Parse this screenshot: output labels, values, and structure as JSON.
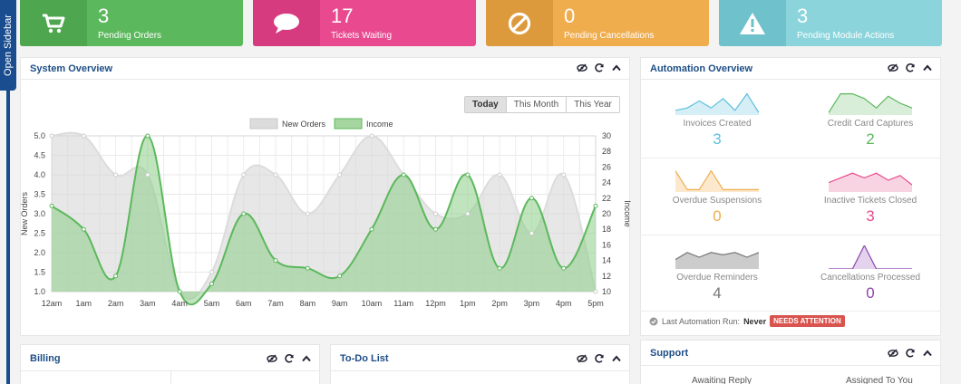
{
  "sidebar": {
    "label": "Open Sidebar"
  },
  "tiles": [
    {
      "value": "3",
      "label": "Pending Orders",
      "icon": "shopping-cart-icon",
      "color": "#5cb85c",
      "icon_bg": "#4ea64e"
    },
    {
      "value": "17",
      "label": "Tickets Waiting",
      "icon": "speech-bubble-icon",
      "color": "#e8498f",
      "icon_bg": "#d63a7f"
    },
    {
      "value": "0",
      "label": "Pending Cancellations",
      "icon": "ban-icon",
      "color": "#f0ad4e",
      "icon_bg": "#dc9a3c"
    },
    {
      "value": "3",
      "label": "Pending Module Actions",
      "icon": "warning-icon",
      "color": "#8bd4dc",
      "icon_bg": "#6fc2cb"
    }
  ],
  "system_overview": {
    "title": "System Overview",
    "ranges": [
      "Today",
      "This Month",
      "This Year"
    ],
    "active_range": "Today"
  },
  "chart_data": {
    "type": "line",
    "categories": [
      "12am",
      "1am",
      "2am",
      "3am",
      "4am",
      "5am",
      "6am",
      "7am",
      "8am",
      "9am",
      "10am",
      "11am",
      "12pm",
      "1pm",
      "2pm",
      "3pm",
      "4pm",
      "5pm"
    ],
    "series": [
      {
        "name": "New Orders",
        "axis": "left",
        "color": "#dcdcdc",
        "values": [
          5.0,
          5.0,
          4.0,
          4.0,
          1.0,
          1.5,
          4.0,
          4.0,
          3.0,
          4.0,
          5.0,
          4.0,
          3.0,
          3.0,
          4.0,
          2.5,
          4.0,
          1.0
        ]
      },
      {
        "name": "Income",
        "axis": "right",
        "color": "#5cb85c",
        "values": [
          21,
          18,
          12,
          30,
          10,
          11,
          20,
          14,
          13,
          12,
          18,
          25,
          18,
          25,
          13,
          22,
          13,
          21
        ]
      }
    ],
    "ylabel": "New Orders",
    "ylabel_right": "Income",
    "ylim": [
      1.0,
      5.0
    ],
    "yticks": [
      "5.0",
      "4.5",
      "4.0",
      "3.5",
      "3.0",
      "2.5",
      "2.0",
      "1.5",
      "1.0"
    ],
    "ylim_right": [
      10,
      30
    ],
    "yticks_right": [
      "30",
      "28",
      "26",
      "24",
      "22",
      "20",
      "18",
      "16",
      "14",
      "12",
      "10"
    ],
    "grid": true,
    "legend": "top"
  },
  "automation": {
    "title": "Automation Overview",
    "items": [
      {
        "label": "Invoices Created",
        "value": "3",
        "color": "#5bc0de",
        "fill": "#d6eef5",
        "spark": [
          0.2,
          0.3,
          0.6,
          0.3,
          0.7,
          0.2,
          0.9,
          0.1
        ]
      },
      {
        "label": "Credit Card Captures",
        "value": "2",
        "color": "#5cb85c",
        "fill": "#d8eed8",
        "spark": [
          0.1,
          0.9,
          0.9,
          0.7,
          0.3,
          0.8,
          0.5,
          0.3
        ]
      },
      {
        "label": "Overdue Suspensions",
        "value": "0",
        "color": "#f0ad4e",
        "fill": "#fbe8cd",
        "spark": [
          0.9,
          0.1,
          0.1,
          0.9,
          0.1,
          0.1,
          0.1,
          0.1
        ]
      },
      {
        "label": "Inactive Tickets Closed",
        "value": "3",
        "color": "#e8498f",
        "fill": "#f8d4e3",
        "spark": [
          0.4,
          0.6,
          0.8,
          0.6,
          0.8,
          0.5,
          0.7,
          0.3
        ]
      },
      {
        "label": "Overdue Reminders",
        "value": "4",
        "color": "#777777",
        "fill": "#cccccc",
        "spark": [
          0.4,
          0.7,
          0.5,
          0.7,
          0.6,
          0.7,
          0.5,
          0.7
        ]
      },
      {
        "label": "Cancellations Processed",
        "value": "0",
        "color": "#8e44ad",
        "fill": "#e3d3ec",
        "spark": [
          0,
          0,
          0,
          1,
          0,
          0,
          0,
          0
        ]
      }
    ],
    "last_run_label": "Last Automation Run:",
    "last_run_value": "Never",
    "badge": "NEEDS ATTENTION"
  },
  "billing": {
    "title": "Billing"
  },
  "todo": {
    "title": "To-Do List"
  },
  "support": {
    "title": "Support",
    "col1": "Awaiting Reply",
    "col2": "Assigned To You"
  }
}
